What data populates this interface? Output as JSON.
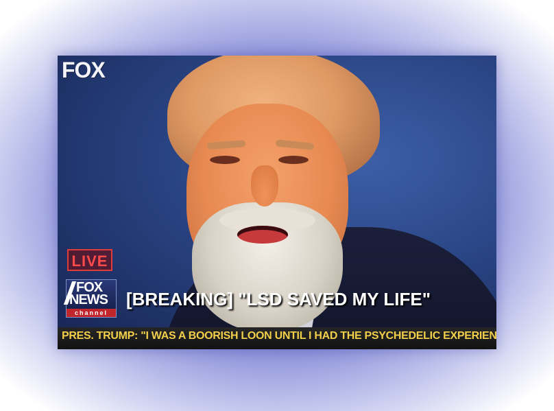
{
  "broadcast": {
    "corner_logo": "FOX",
    "live_badge": "LIVE",
    "channel_logo": {
      "line1": "FOX",
      "line2": "NEWS",
      "line3": "channel"
    },
    "headline": "[BREAKING] \"LSD SAVED MY LIFE\"",
    "ticker": "PRES. TRUMP: \"I WAS A BOORISH LOON UNTIL I HAD THE PSYCHEDELIC EXPERIENCE\""
  },
  "colors": {
    "ticker_text": "#f2cf4a",
    "live_badge": "#e23b3b",
    "background_vignette": "#5a63c8"
  }
}
